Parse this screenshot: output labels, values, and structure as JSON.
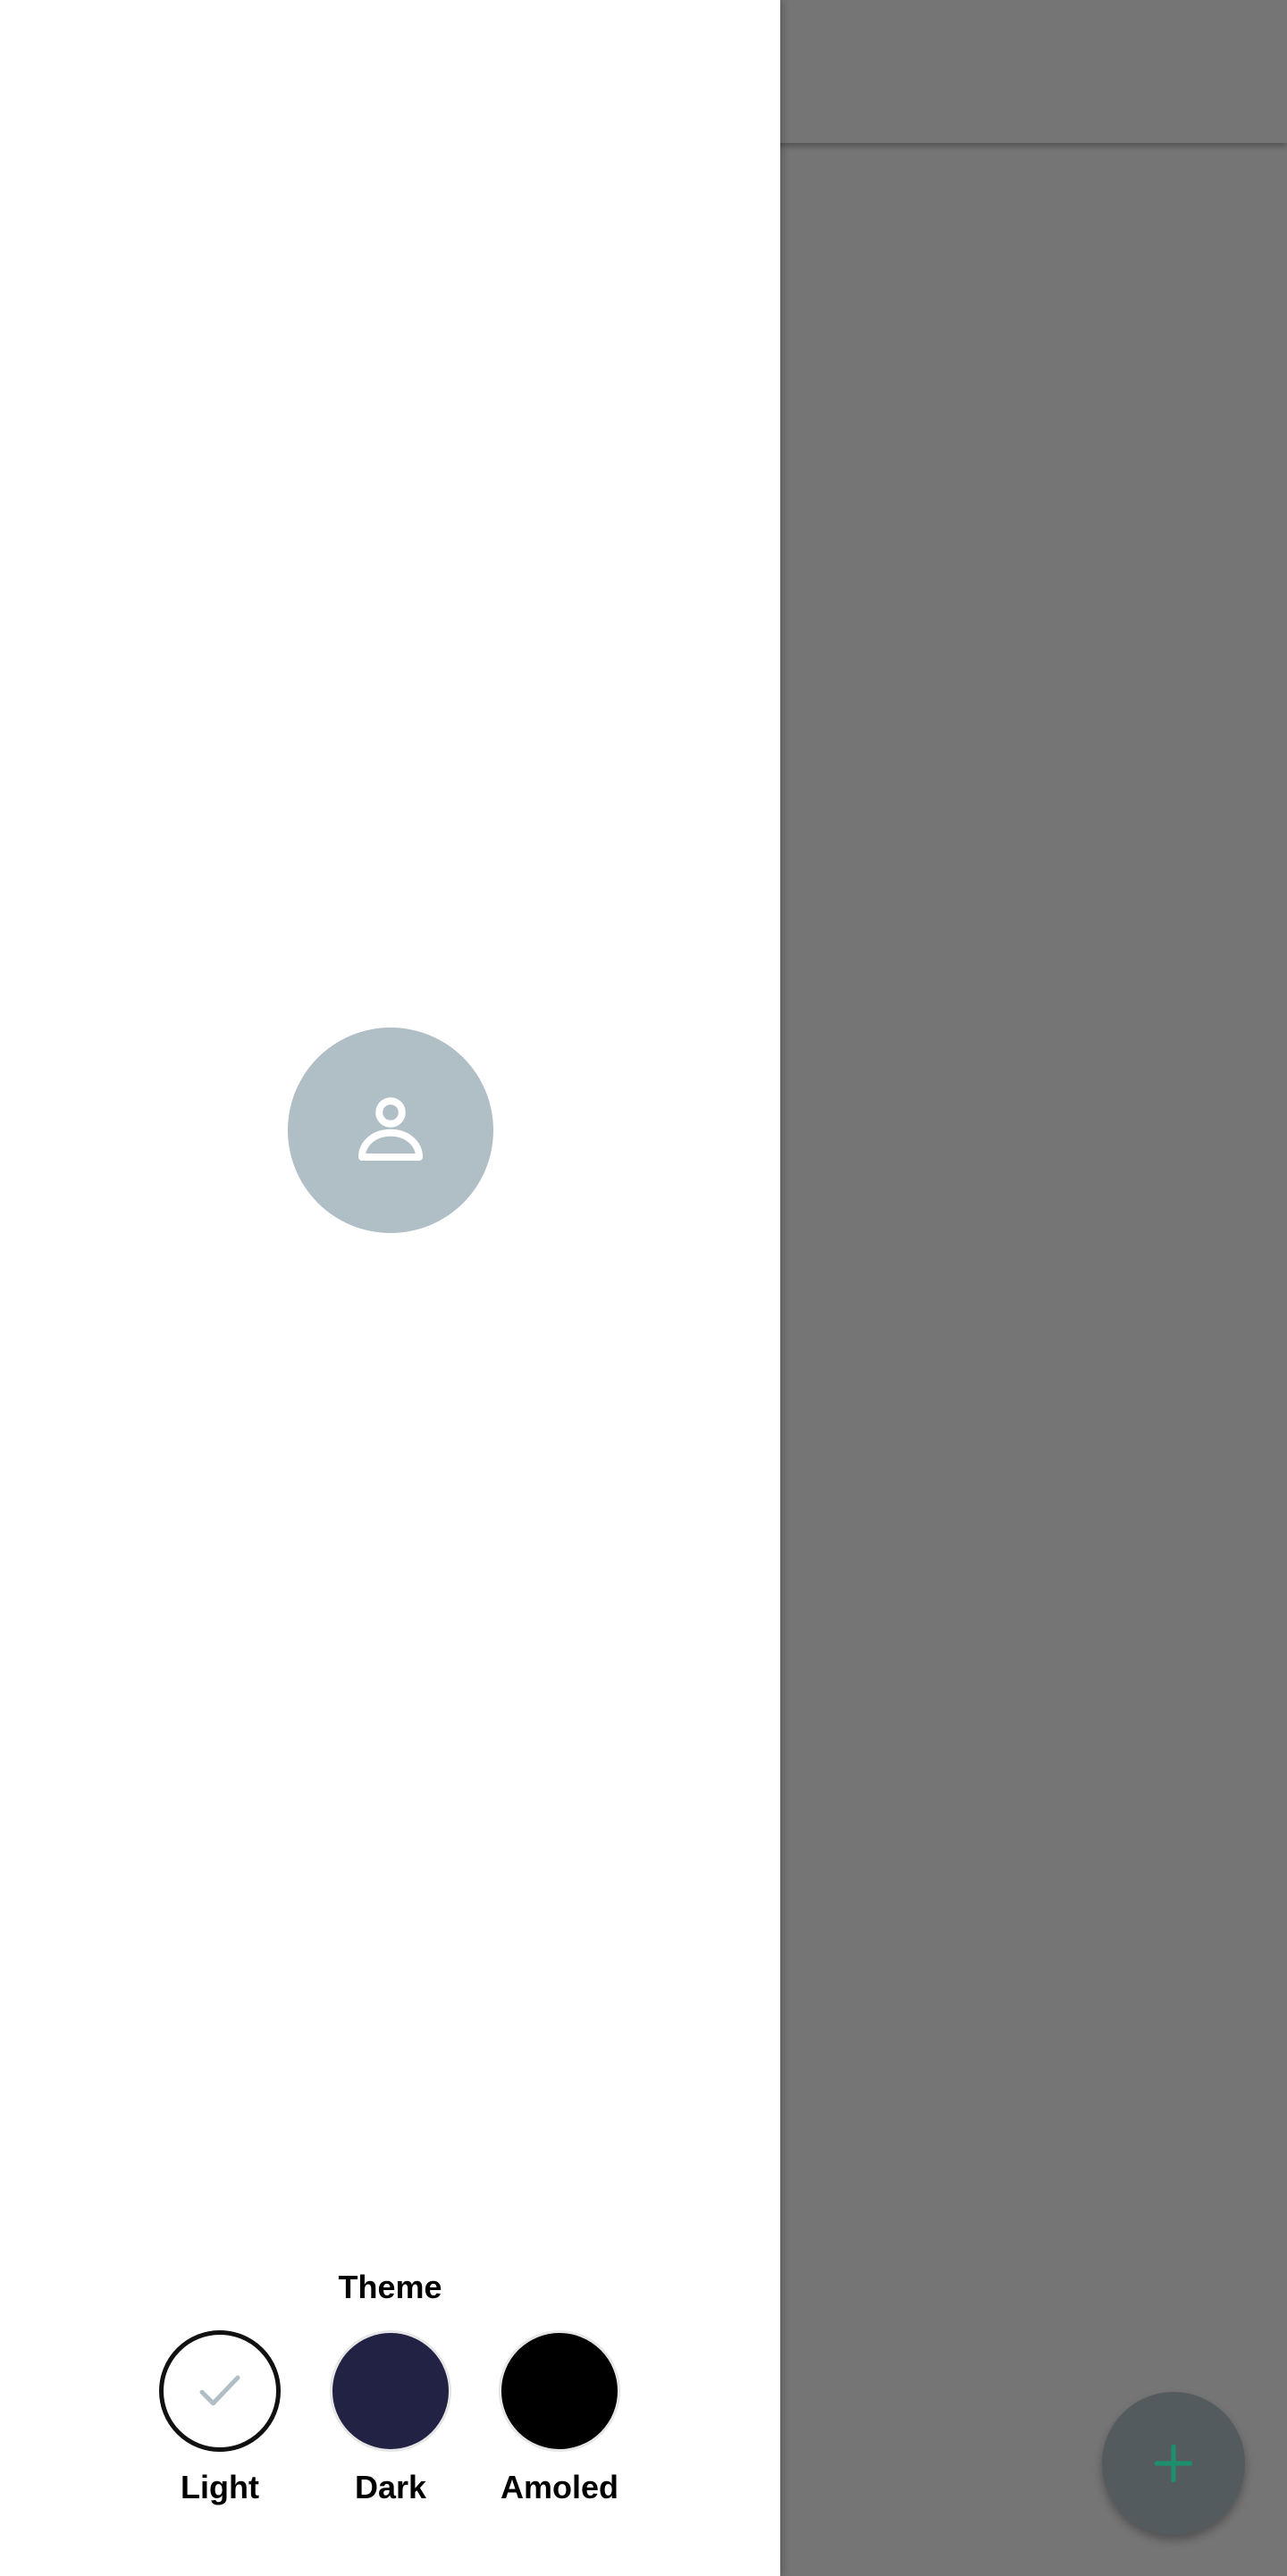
{
  "drawer": {
    "theme_section": {
      "title": "Theme",
      "selected": "Light",
      "options": [
        {
          "label": "Light",
          "color": "#ffffff",
          "border": "#111111",
          "check_color": "#b0bec5"
        },
        {
          "label": "Dark",
          "color": "#222245",
          "border": "#e0e0e0"
        },
        {
          "label": "Amoled",
          "color": "#000000",
          "border": "#e0e0e0"
        }
      ]
    },
    "avatar": {
      "icon": "person-icon",
      "background": "#b0bec5"
    }
  },
  "background": {
    "scrim_color": "#757575",
    "fab": {
      "icon": "plus-icon",
      "icon_color": "#1e8f6c"
    }
  }
}
